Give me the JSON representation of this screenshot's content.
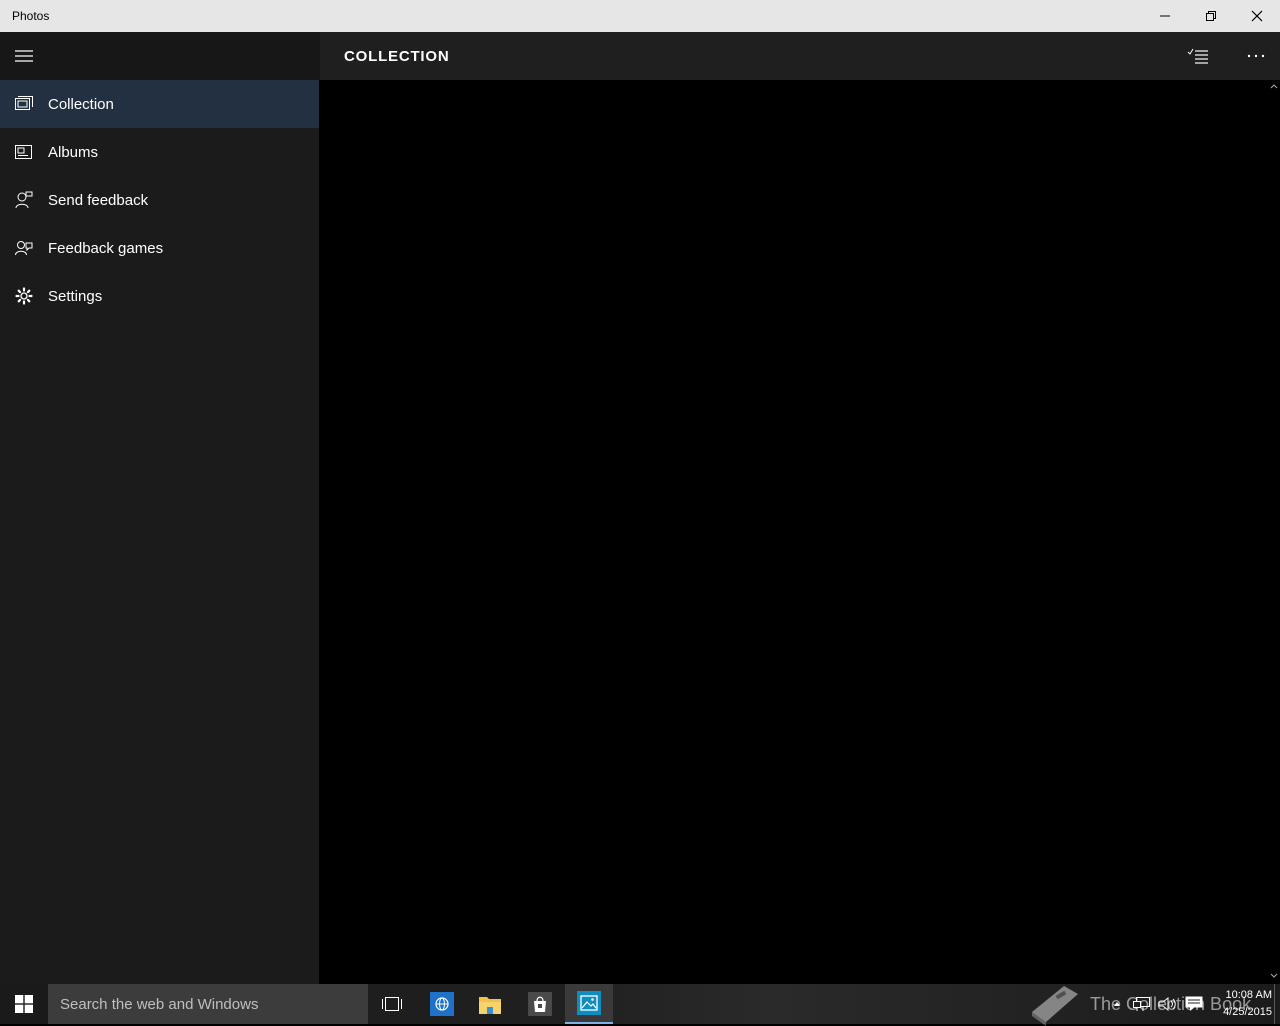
{
  "window": {
    "title": "Photos"
  },
  "header": {
    "page_title": "COLLECTION"
  },
  "sidebar": {
    "items": [
      {
        "label": "Collection",
        "icon": "collection-icon",
        "selected": true
      },
      {
        "label": "Albums",
        "icon": "albums-icon",
        "selected": false
      },
      {
        "label": "Send feedback",
        "icon": "feedback-icon",
        "selected": false
      },
      {
        "label": "Feedback games",
        "icon": "feedback-games-icon",
        "selected": false
      },
      {
        "label": "Settings",
        "icon": "gear-icon",
        "selected": false
      }
    ]
  },
  "taskbar": {
    "search_placeholder": "Search the web and Windows",
    "watermark": "The Collection Book",
    "time": "10:08 AM",
    "date": "4/25/2015"
  },
  "colors": {
    "sidebar_bg": "#1b1b1b",
    "selected_bg": "#233042",
    "header_bg": "#1f1f1f",
    "titlebar_bg": "#e6e6e6"
  }
}
